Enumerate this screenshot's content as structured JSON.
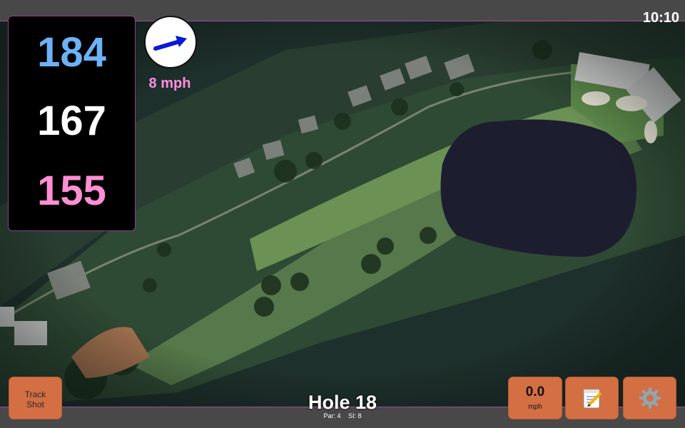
{
  "status_bar": {
    "time": "10:10"
  },
  "distances": {
    "back": {
      "value": "184",
      "color": "#6db2f6"
    },
    "middle": {
      "value": "167",
      "color": "#ffffff"
    },
    "front": {
      "value": "155",
      "color": "#ff8ed4"
    }
  },
  "wind": {
    "speed": "8 mph",
    "arrow_color": "#0a18d8",
    "direction_icon": "arrow-icon"
  },
  "buttons": {
    "track_shot": [
      "Track",
      "Shot"
    ],
    "speed_value": "0.0",
    "speed_unit": "mph",
    "notes_icon": "notepad-icon",
    "settings_icon": "gear-icon"
  },
  "hole": {
    "title": "Hole 18",
    "par": "Par: 4",
    "si": "SI: 8"
  },
  "colors": {
    "accent_border": "#9a4f9a",
    "button": "#d36f43",
    "bar": "#484848"
  }
}
